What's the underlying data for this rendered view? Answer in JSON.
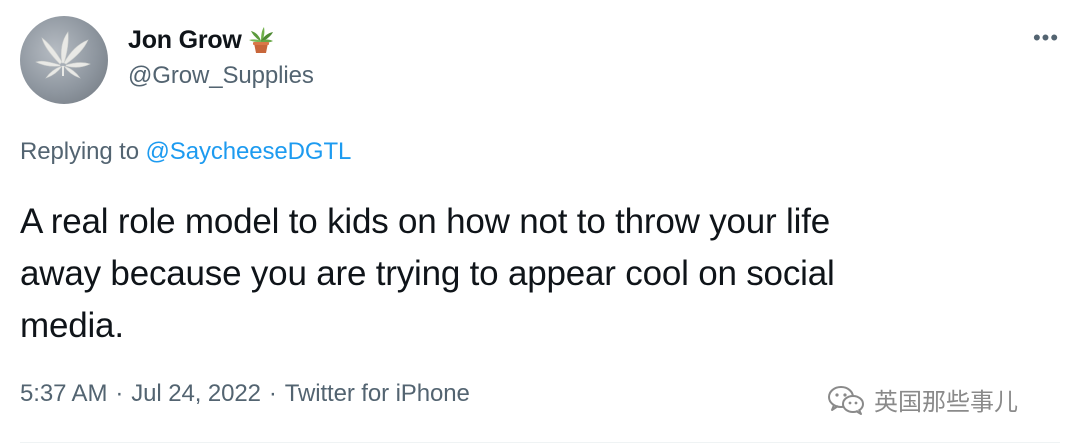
{
  "author": {
    "display_name": "Jon Grow",
    "name_emoji": "potted-plant-emoji",
    "handle": "@Grow_Supplies",
    "avatar": "cannabis-leaf-avatar"
  },
  "header": {
    "more_label": "•••"
  },
  "reply": {
    "prefix": "Replying to ",
    "target": "@SaycheeseDGTL"
  },
  "tweet": {
    "text": "A real role model to kids on how not to throw your life\naway because you are trying to appear cool on social\nmedia."
  },
  "meta": {
    "time": "5:37 AM",
    "separator": "·",
    "date": "Jul 24, 2022",
    "source": "Twitter for iPhone"
  },
  "watermark": {
    "icon": "wechat-icon",
    "text": "英国那些事儿"
  },
  "colors": {
    "text": "#0f1419",
    "secondary": "#536471",
    "link": "#1d9bf0"
  }
}
